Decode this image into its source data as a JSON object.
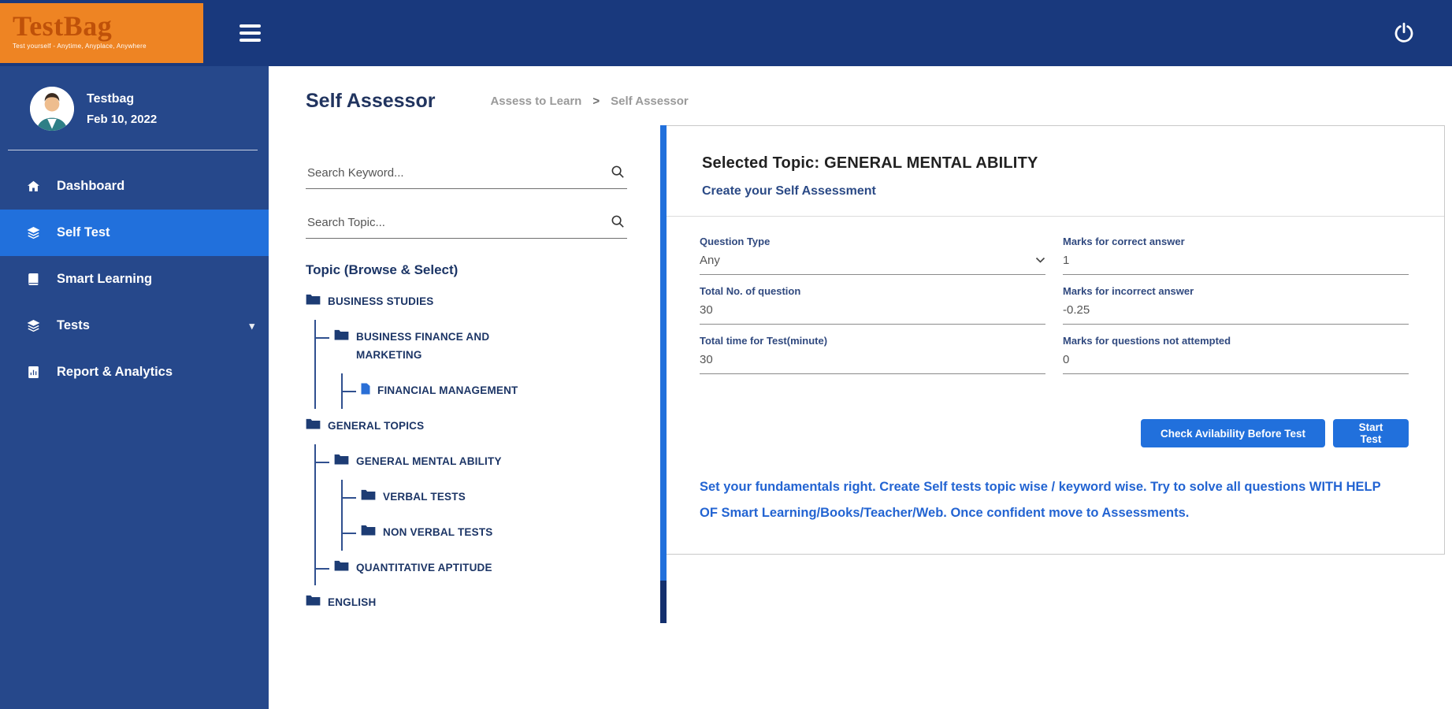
{
  "colors": {
    "topbar": "#19397d",
    "sidebar": "#26488b",
    "active_item": "#2170dc",
    "primary_button": "#2170dc",
    "logo_background": "#ee8423",
    "navy_text": "#1c3566",
    "note_blue": "#2364d2"
  },
  "topbar": {
    "logo_title": "TestBag",
    "logo_tagline": "Test yourself - Anytime, Anyplace, Anywhere"
  },
  "sidebar": {
    "profile": {
      "name": "Testbag",
      "date": "Feb 10, 2022"
    },
    "items": [
      {
        "label": "Dashboard",
        "icon": "home-icon",
        "active": false
      },
      {
        "label": "Self Test",
        "icon": "layers-icon",
        "active": true
      },
      {
        "label": "Smart Learning",
        "icon": "book-icon",
        "active": false
      },
      {
        "label": "Tests",
        "icon": "layers-icon",
        "active": false,
        "has_chevron": true
      },
      {
        "label": "Report & Analytics",
        "icon": "report-icon",
        "active": false
      }
    ]
  },
  "header": {
    "title": "Self Assessor",
    "breadcrumb": [
      "Assess to Learn",
      "Self Assessor"
    ],
    "breadcrumb_separator": ">"
  },
  "search": {
    "keyword_placeholder": "Search Keyword...",
    "topic_placeholder": "Search Topic..."
  },
  "tree": {
    "heading": "Topic (Browse & Select)",
    "nodes": [
      {
        "label": "BUSINESS STUDIES",
        "level": 0,
        "type": "folder"
      },
      {
        "label": "BUSINESS FINANCE AND MARKETING",
        "level": 1,
        "type": "folder"
      },
      {
        "label": "FINANCIAL MANAGEMENT",
        "level": 2,
        "type": "file"
      },
      {
        "label": "GENERAL TOPICS",
        "level": 0,
        "type": "folder"
      },
      {
        "label": "GENERAL MENTAL ABILITY",
        "level": 1,
        "type": "folder"
      },
      {
        "label": "VERBAL TESTS",
        "level": 2,
        "type": "folder"
      },
      {
        "label": "NON VERBAL TESTS",
        "level": 2,
        "type": "folder"
      },
      {
        "label": "QUANTITATIVE APTITUDE",
        "level": 1,
        "type": "folder"
      },
      {
        "label": "ENGLISH",
        "level": 0,
        "type": "folder"
      }
    ]
  },
  "card": {
    "selected_topic": "Selected Topic: GENERAL MENTAL ABILITY",
    "subtitle": "Create your Self Assessment",
    "fields": {
      "question_type": {
        "label": "Question Type",
        "value": "Any"
      },
      "total_questions": {
        "label": "Total No. of question",
        "value": "30"
      },
      "total_time": {
        "label": "Total time for Test(minute)",
        "value": "30"
      },
      "marks_correct": {
        "label": "Marks for correct answer",
        "value": "1"
      },
      "marks_incorrect": {
        "label": "Marks for incorrect answer",
        "value": "-0.25"
      },
      "marks_unattempted": {
        "label": "Marks for questions not attempted",
        "value": "0"
      }
    },
    "buttons": {
      "check_availability": "Check Avilability Before Test",
      "start_test": "Start Test"
    },
    "note": "Set your fundamentals right. Create Self tests topic wise / keyword wise. Try to solve all questions WITH HELP OF Smart Learning/Books/Teacher/Web. Once confident move to Assessments."
  }
}
